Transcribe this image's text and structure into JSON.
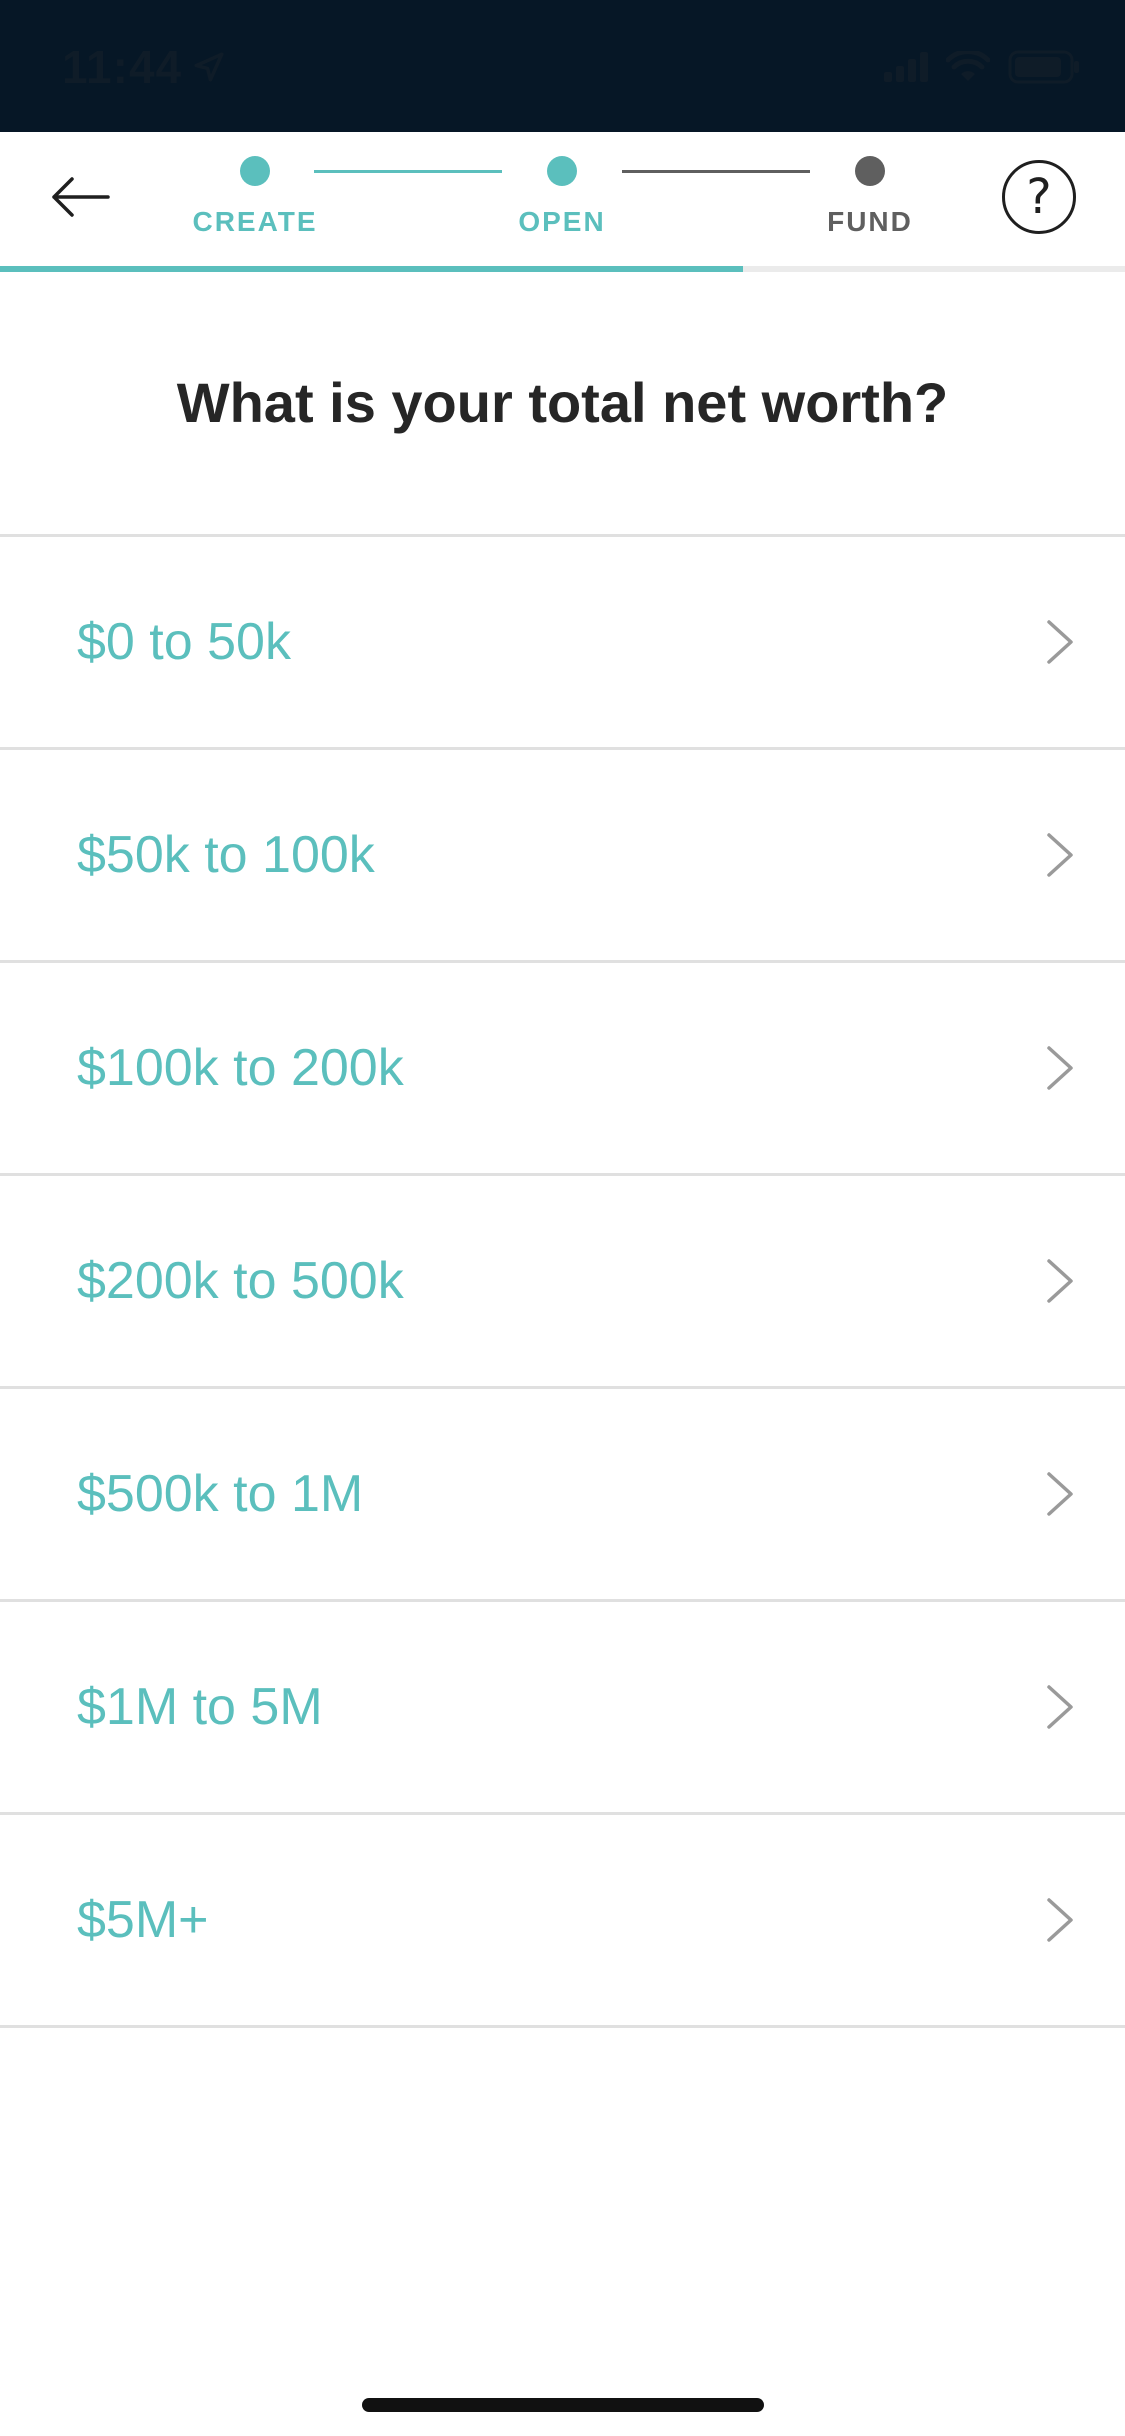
{
  "status_bar": {
    "time": "11:44",
    "icons": [
      "location-arrow-icon",
      "cellular-signal-icon",
      "wifi-icon",
      "battery-icon"
    ]
  },
  "header": {
    "back_icon": "arrow-left-icon",
    "help_label": "?",
    "steps": [
      {
        "label": "CREATE",
        "state": "complete"
      },
      {
        "label": "OPEN",
        "state": "current"
      },
      {
        "label": "FUND",
        "state": "upcoming"
      }
    ],
    "progress_fraction": 0.66
  },
  "question": "What is your total net worth?",
  "options": [
    {
      "label": "$0 to 50k"
    },
    {
      "label": "$50k to 100k"
    },
    {
      "label": "$100k to 200k"
    },
    {
      "label": "$200k to 500k"
    },
    {
      "label": "$500k to 1M"
    },
    {
      "label": "$1M to 5M"
    },
    {
      "label": "$5M+"
    }
  ],
  "colors": {
    "accent": "#5bbfbd",
    "inactive": "#5f5f5f",
    "status_bar_bg": "#061726",
    "divider": "#e0e0e0"
  }
}
